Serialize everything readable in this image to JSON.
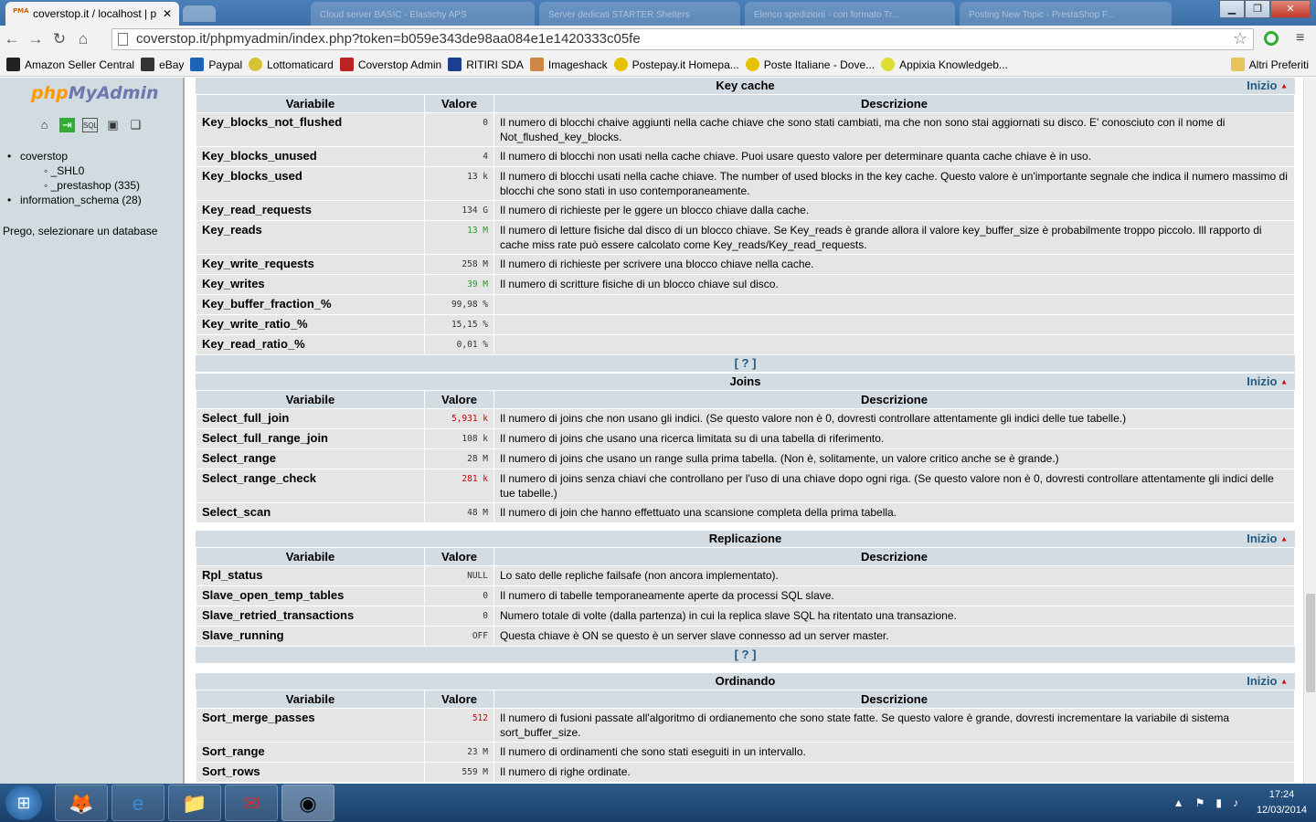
{
  "browser": {
    "active_tab": "coverstop.it / localhost | p",
    "bg_tabs": [
      "Cloud server BASIC - Elastichy APS",
      "Server dedicati STARTER Shelters",
      "Elenco spedizioni - con formato Tr...",
      "Posting New Topic - PrestaShop F..."
    ],
    "url": "coverstop.it/phpmyadmin/index.php?token=b059e343de98aa084e1e1420333c05fe",
    "bookmarks": [
      "Amazon Seller Central",
      "eBay",
      "Paypal",
      "Lottomaticard",
      "Coverstop Admin",
      "RITIRI SDA",
      "Imageshack",
      "Postepay.it Homepa...",
      "Poste Italiane - Dove...",
      "Appixia Knowledgeb..."
    ],
    "other_bookmarks": "Altri Preferiti"
  },
  "left": {
    "logo_php": "php",
    "logo_rest": "MyAdmin",
    "db": "coverstop",
    "subs": [
      "_SHL0",
      "_prestashop (335)"
    ],
    "db2": "information_schema (28)",
    "prego": "Prego, selezionare un database"
  },
  "cols": {
    "var": "Variabile",
    "val": "Valore",
    "desc": "Descrizione"
  },
  "inizio": "Inizio",
  "doc_link": "[ ? ]",
  "key_cache": {
    "title": "Key cache",
    "rows": [
      {
        "var": "Key_blocks_not_flushed",
        "val": "0",
        "desc": "Il numero di blocchi chaive aggiunti nella cache chiave che sono stati cambiati, ma che non sono stai aggiornati su disco. E' conosciuto con il nome di Not_flushed_key_blocks."
      },
      {
        "var": "Key_blocks_unused",
        "val": "4",
        "desc": "Il numero di blocchi non usati nella cache chiave. Puoi usare questo valore per determinare quanta cache chiave è in uso."
      },
      {
        "var": "Key_blocks_used",
        "val": "13 k",
        "desc": "Il numero di blocchi usati nella cache chiave. The number of used blocks in the key cache. Questo valore è un'importante segnale che indica il numero massimo di blocchi che sono stati in uso contemporaneamente."
      },
      {
        "var": "Key_read_requests",
        "val": "134 G",
        "desc": "Il numero di richieste per le ggere un blocco chiave dalla cache."
      },
      {
        "var": "Key_reads",
        "val": "13 M",
        "desc": "Il numero di letture fisiche dal disco di un blocco chiave. Se Key_reads è grande allora il valore key_buffer_size è probabilmente troppo piccolo. Ill rapporto di cache miss rate può essere calcolato come Key_reads/Key_read_requests."
      },
      {
        "var": "Key_write_requests",
        "val": "258 M",
        "desc": "Il numero di richieste per scrivere una blocco chiave nella cache."
      },
      {
        "var": "Key_writes",
        "val": "39 M",
        "desc": "Il numero di scritture fisiche di un blocco chiave sul disco."
      },
      {
        "var": "Key_buffer_fraction_%",
        "val": "99,98 %",
        "desc": ""
      },
      {
        "var": "Key_write_ratio_%",
        "val": "15,15 %",
        "desc": ""
      },
      {
        "var": "Key_read_ratio_%",
        "val": "0,01 %",
        "desc": ""
      }
    ]
  },
  "joins": {
    "title": "Joins",
    "rows": [
      {
        "var": "Select_full_join",
        "val": "5,931 k",
        "desc": "Il numero di joins che non usano gli indici. (Se questo valore non è 0, dovresti controllare attentamente gli indici delle tue tabelle.)"
      },
      {
        "var": "Select_full_range_join",
        "val": "108 k",
        "desc": "Il numero di joins che usano una ricerca limitata su di una tabella di riferimento."
      },
      {
        "var": "Select_range",
        "val": "28 M",
        "desc": "Il numero di joins che usano un range sulla prima tabella. (Non è, solitamente, un valore critico anche se è grande.)"
      },
      {
        "var": "Select_range_check",
        "val": "281 k",
        "desc": "Il numero di joins senza chiavi che controllano per l'uso di una chiave dopo ogni riga. (Se questo valore non è 0, dovresti controllare attentamente gli indici delle tue tabelle.)"
      },
      {
        "var": "Select_scan",
        "val": "48 M",
        "desc": "Il numero di join che hanno effettuato una scansione completa della prima tabella."
      }
    ]
  },
  "repl": {
    "title": "Replicazione",
    "rows": [
      {
        "var": "Rpl_status",
        "val": "NULL",
        "desc": "Lo sato delle repliche failsafe (non ancora implementato)."
      },
      {
        "var": "Slave_open_temp_tables",
        "val": "0",
        "desc": "Il numero di tabelle temporaneamente aperte da processi SQL slave."
      },
      {
        "var": "Slave_retried_transactions",
        "val": "0",
        "desc": "Numero totale di volte (dalla partenza) in cui la replica slave SQL ha ritentato una transazione."
      },
      {
        "var": "Slave_running",
        "val": "OFF",
        "desc": "Questa chiave è ON se questo è un server slave connesso ad un server master."
      }
    ]
  },
  "sort": {
    "title": "Ordinando",
    "rows": [
      {
        "var": "Sort_merge_passes",
        "val": "512",
        "desc": "Il numero di fusioni passate all'algoritmo di ordianemento che sono state fatte. Se questo valore è grande, dovresti incrementare la variabile di sistema sort_buffer_size."
      },
      {
        "var": "Sort_range",
        "val": "23 M",
        "desc": "Il numero di ordinamenti che sono stati eseguiti in un intervallo."
      },
      {
        "var": "Sort_rows",
        "val": "559 M",
        "desc": "Il numero di righe ordinate."
      }
    ]
  },
  "taskbar": {
    "time": "17:24",
    "date": "12/03/2014"
  },
  "colors": {
    "header": "#d3dce3",
    "row": "#e5e5e5",
    "link": "#235a81",
    "green": "#2a9b2a",
    "red": "#d00000"
  }
}
